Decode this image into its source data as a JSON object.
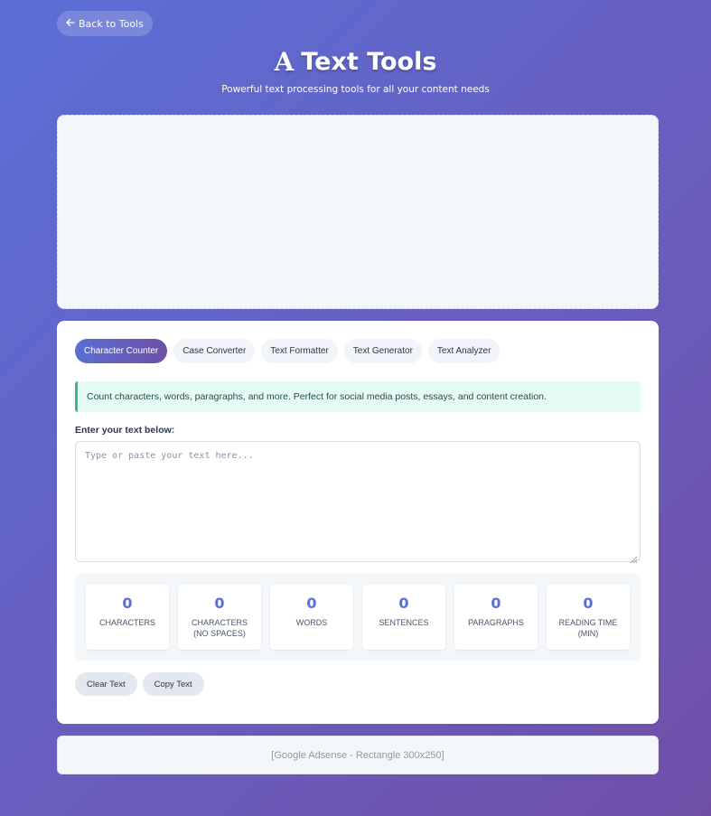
{
  "nav": {
    "back_label": "Back to Tools",
    "back_icon": "arrow-left-icon"
  },
  "header": {
    "title_glyph": "A",
    "title": "Text Tools",
    "subtitle": "Powerful text processing tools for all your content needs"
  },
  "tabs": [
    {
      "label": "Character Counter",
      "active": true
    },
    {
      "label": "Case Converter",
      "active": false
    },
    {
      "label": "Text Formatter",
      "active": false
    },
    {
      "label": "Text Generator",
      "active": false
    },
    {
      "label": "Text Analyzer",
      "active": false
    }
  ],
  "info": {
    "text": "Count characters, words, paragraphs, and more. Perfect for social media posts, essays, and content creation."
  },
  "editor": {
    "label": "Enter your text below:",
    "value": "",
    "placeholder": "Type or paste your text here..."
  },
  "stats": [
    {
      "value": "0",
      "label": "Characters"
    },
    {
      "value": "0",
      "label": "Characters (No Spaces)"
    },
    {
      "value": "0",
      "label": "Words"
    },
    {
      "value": "0",
      "label": "Sentences"
    },
    {
      "value": "0",
      "label": "Paragraphs"
    },
    {
      "value": "0",
      "label": "Reading Time (min)"
    }
  ],
  "actions": {
    "clear_label": "Clear Text",
    "copy_label": "Copy Text"
  },
  "ad_bottom": {
    "text": "[Google Adsense - Rectangle 300x250]"
  },
  "colors": {
    "accent": "#5a6fd6",
    "accent_end": "#6f4fa6",
    "info_border": "#34b79a"
  }
}
